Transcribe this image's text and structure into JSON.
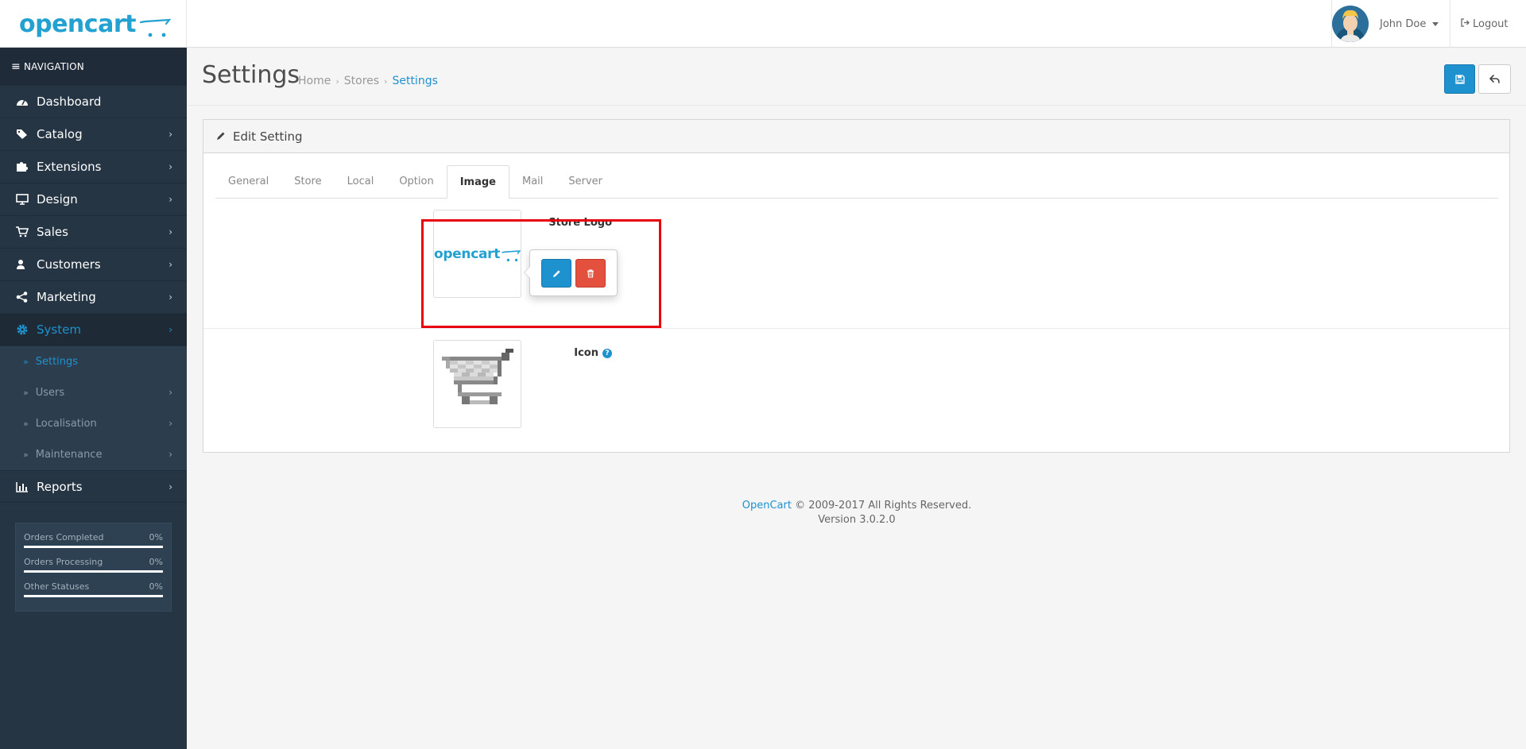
{
  "header": {
    "logo_text": "opencart",
    "user_name": "John Doe",
    "logout_label": "Logout"
  },
  "sidebar": {
    "nav_title": "NAVIGATION",
    "items": [
      {
        "label": "Dashboard",
        "icon": "dashboard-icon",
        "has_children": false
      },
      {
        "label": "Catalog",
        "icon": "tags-icon",
        "has_children": true
      },
      {
        "label": "Extensions",
        "icon": "puzzle-icon",
        "has_children": true
      },
      {
        "label": "Design",
        "icon": "monitor-icon",
        "has_children": true
      },
      {
        "label": "Sales",
        "icon": "cart-icon",
        "has_children": true
      },
      {
        "label": "Customers",
        "icon": "user-icon",
        "has_children": true
      },
      {
        "label": "Marketing",
        "icon": "share-icon",
        "has_children": true
      },
      {
        "label": "System",
        "icon": "gear-icon",
        "has_children": true,
        "active": true
      }
    ],
    "system_children": [
      {
        "label": "Settings",
        "current": true
      },
      {
        "label": "Users",
        "has_children": true
      },
      {
        "label": "Localisation",
        "has_children": true
      },
      {
        "label": "Maintenance",
        "has_children": true
      }
    ],
    "reports_label": "Reports",
    "stats": [
      {
        "label": "Orders Completed",
        "value": "0%",
        "fraction": 0
      },
      {
        "label": "Orders Processing",
        "value": "0%",
        "fraction": 0
      },
      {
        "label": "Other Statuses",
        "value": "0%",
        "fraction": 0
      }
    ]
  },
  "page": {
    "title": "Settings",
    "breadcrumb": [
      "Home",
      "Stores",
      "Settings"
    ]
  },
  "panel": {
    "heading": "Edit Setting",
    "tabs": [
      "General",
      "Store",
      "Local",
      "Option",
      "Image",
      "Mail",
      "Server"
    ],
    "active_tab": "Image",
    "fields": {
      "store_logo_label": "Store Logo",
      "icon_label": "Icon",
      "logo_thumb_text": "opencart"
    }
  },
  "colors": {
    "accent": "#1e91cf",
    "sidebar_bg": "#263544",
    "danger": "#e3503e",
    "highlight": "#e8000d"
  },
  "footer": {
    "brand": "OpenCart",
    "copyright": "© 2009-2017 All Rights Reserved.",
    "version": "Version 3.0.2.0"
  }
}
